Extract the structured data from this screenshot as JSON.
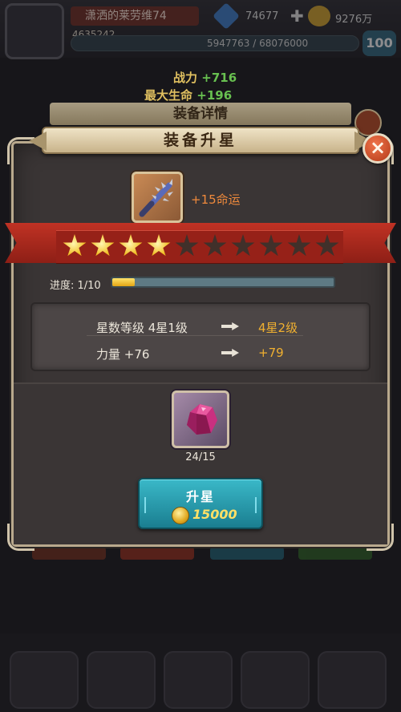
{
  "hud": {
    "player_name": "潇洒的莱劳维74",
    "player_power": "4635242",
    "gems": "74677",
    "coins": "9276万",
    "exp": "5947763 / 68076000",
    "level": "100"
  },
  "floating_stats": [
    {
      "name": "战力",
      "value": "+716"
    },
    {
      "name": "最大生命",
      "value": "+196"
    }
  ],
  "back_panel": {
    "title": "装备详情"
  },
  "dialog": {
    "title": "装备升星",
    "close_icon": "×",
    "item_icon": "spiked-club-icon",
    "item_bonus": "+15命运",
    "stars_total": 10,
    "stars_filled": 4,
    "progress_label": "进度: 1/10",
    "progress_fraction": 0.1,
    "compare": [
      {
        "left": "星数等级 4星1级",
        "right": "4星2级"
      },
      {
        "left": "力量 +76",
        "right": "+79"
      }
    ],
    "material_icon": "purple-gem-icon",
    "material_count": "24/15",
    "upgrade_button": {
      "label": "升星",
      "cost": "15000"
    }
  },
  "colors": {
    "accent_red": "#c03224",
    "star_on": "#f2c12a",
    "button_teal": "#2aa0b2",
    "highlight_gold": "#f0b030",
    "bonus_orange": "#f08a3c"
  }
}
